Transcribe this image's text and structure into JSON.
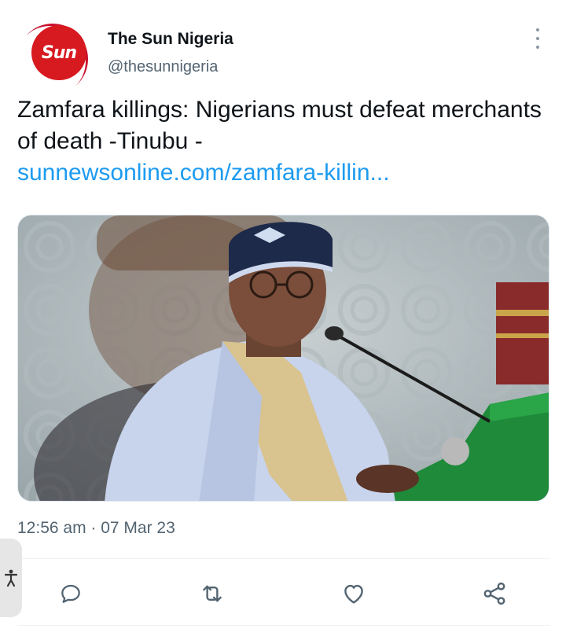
{
  "author": {
    "avatar_text": "Sun",
    "name": "The Sun Nigeria",
    "handle": "@thesunnigeria"
  },
  "tweet": {
    "text": "Zamfara killings: Nigerians must defeat merchants of death -Tinubu -",
    "link": "sunnewsonline.com/zamfara-killin...",
    "timestamp": "12:56 am · 07 Mar 23"
  },
  "icons": {
    "more": "more-vertical-icon",
    "reply": "reply-icon",
    "retweet": "retweet-icon",
    "like": "heart-icon",
    "share": "share-icon",
    "accessibility": "accessibility-icon"
  },
  "colors": {
    "brand_red": "#d71920",
    "link_blue": "#1d9bf0",
    "secondary_text": "#536471",
    "icon_gray": "#536471"
  }
}
